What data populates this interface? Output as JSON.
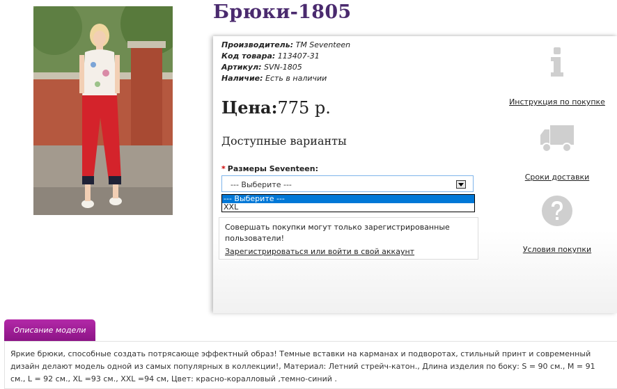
{
  "product": {
    "title": "Брюки-1805",
    "price_label": "Цена:",
    "price_value": "775 р."
  },
  "specs": [
    {
      "label": "Производитель:",
      "value": "TM Seventeen"
    },
    {
      "label": "Код товара:",
      "value": "113407-31"
    },
    {
      "label": "Артикул:",
      "value": "SVN-1805"
    },
    {
      "label": "Наличие:",
      "value": "Есть в наличии"
    }
  ],
  "variants": {
    "title": "Доступные варианты",
    "required_mark": "*",
    "option_label": "Размеры Seventeen:",
    "selected": "--- Выберите ---",
    "options": [
      "--- Выберите ---",
      "XXL"
    ]
  },
  "login_notice": {
    "text": "Совершать покупки могут только зарегистрированные пользователи!",
    "link": "Зарегистрироваться или войти в свой аккаунт"
  },
  "side_links": [
    {
      "icon": "info-icon",
      "label": "Инструкция по покупке"
    },
    {
      "icon": "truck-icon",
      "label": "Сроки доставки"
    },
    {
      "icon": "question-icon",
      "label": "Условия покупки"
    }
  ],
  "tabs": {
    "description_label": "Описание модели"
  },
  "description": {
    "text": "Яркие брюки, способные создать потрясающе эффектный образ! Темные вставки на карманах и подворотах, стильный принт и современный дизайн делают модель одной из самых популярных в коллекции!, Материал: Летний стрейч-катон., Длина изделия по боку: S = 90 см., M = 91 см., L = 92 см., XL =93 см., XXL =94 см, Цвет: красно-коралловый ,темно-синий ."
  },
  "colors": {
    "title": "#4a2a6e",
    "tab": "#a0209a",
    "select_border": "#7eb4ea",
    "highlight": "#0078d7",
    "required": "#cc0000",
    "icon_gray": "#cfcfcf"
  }
}
